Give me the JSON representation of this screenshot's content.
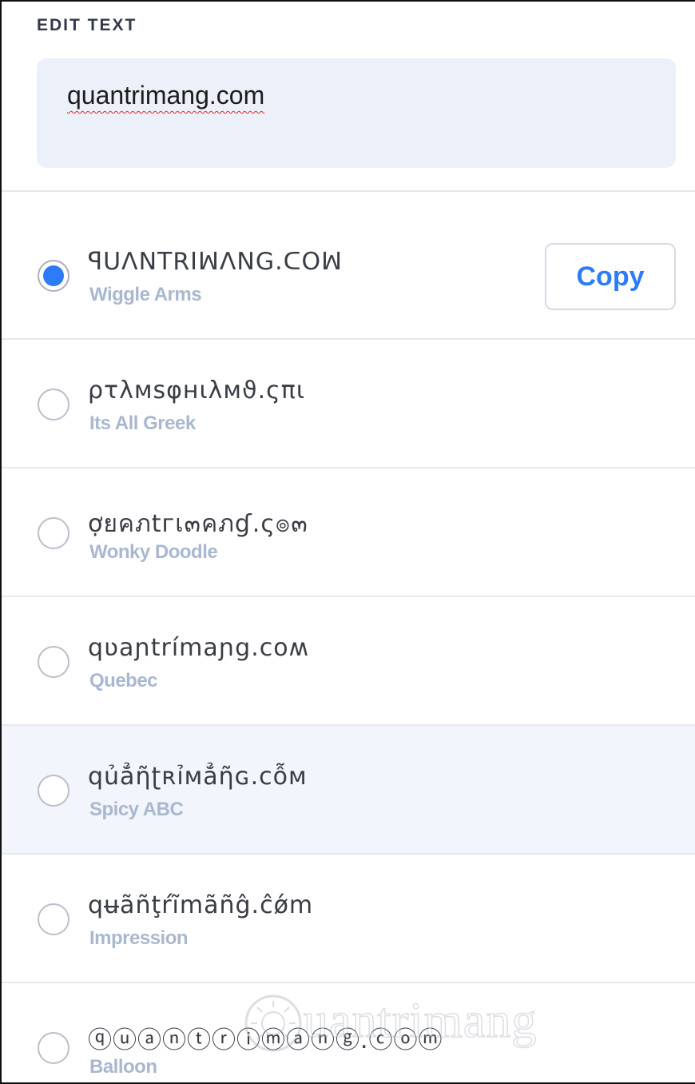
{
  "editor": {
    "label": "EDIT TEXT",
    "value": "quantrimang.com"
  },
  "styles": [
    {
      "text": "ꟼUꓥꓠTꓣIꟽꓥꓠꓖ.ᑕOꟽ",
      "name": "Wiggle Arms",
      "selected": true,
      "copy_label": "Copy"
    },
    {
      "text": "ρτλмѕφнιλмϑ.ςπι",
      "name": "Its All Greek",
      "selected": false
    },
    {
      "text": "ợยคภtгเ๓คภɠ.ς๏๓",
      "name": "Wonky Doodle",
      "selected": false
    },
    {
      "text": "qʋaɲtrímaɲg.coʍ",
      "name": "Quebec",
      "selected": false
    },
    {
      "text": "qủẳῆʈʀỉмẳῆɢ.cỗм",
      "name": "Spicy ABC",
      "selected": false,
      "highlighted": true
    },
    {
      "text": "qʉãñţŕĩmãñĝ.ĉǿm",
      "name": "Impression",
      "selected": false
    },
    {
      "text": "ⓠⓤⓐⓝⓣⓡⓘⓜⓐⓝⓖ.ⓒⓞⓜ",
      "name": "Balloon",
      "selected": false
    }
  ],
  "watermark": {
    "text": "uantrimang"
  }
}
